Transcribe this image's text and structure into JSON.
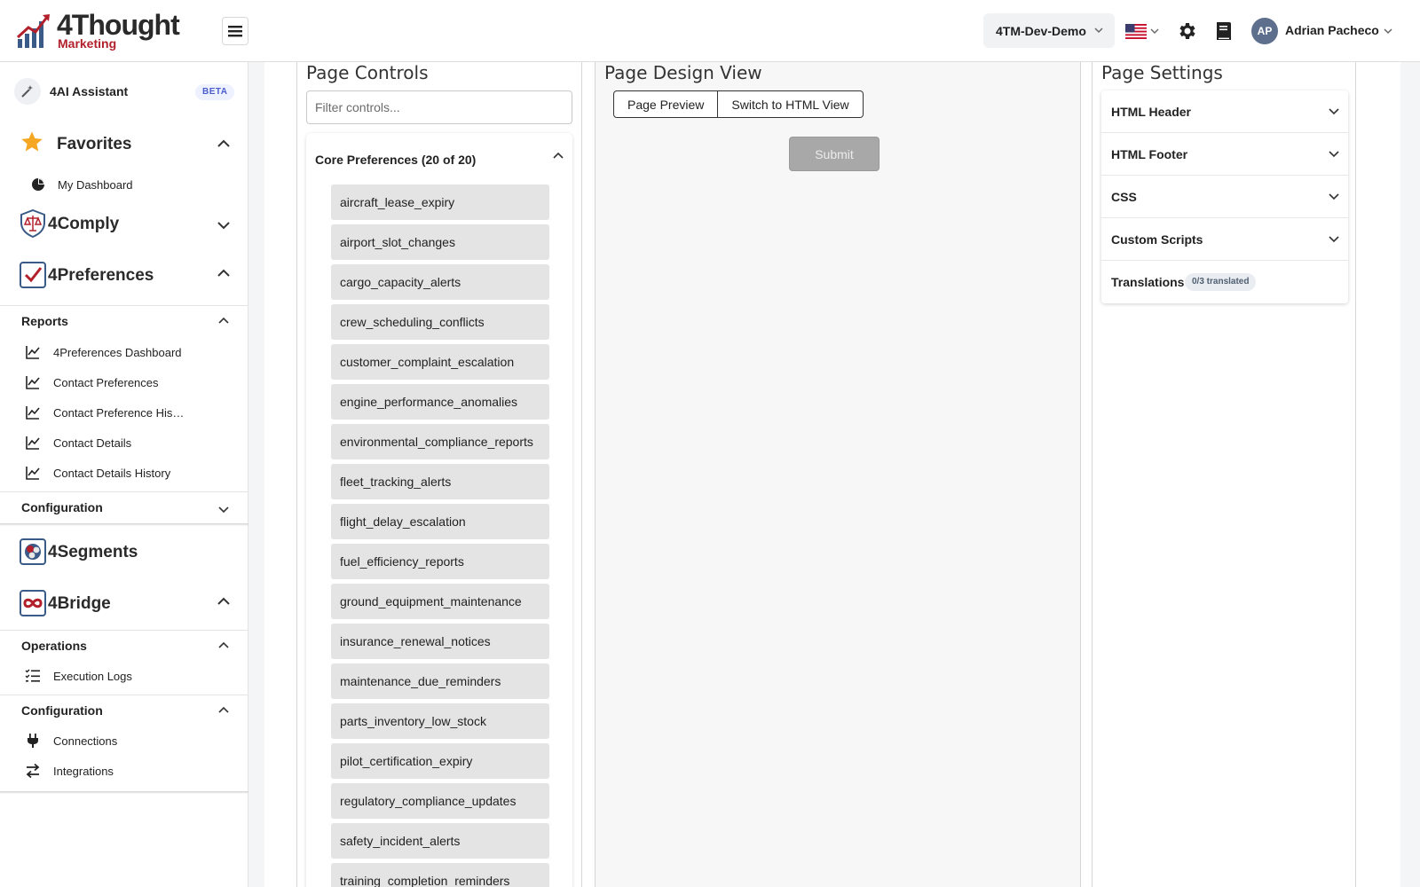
{
  "header": {
    "logo_name": "4Thought",
    "logo_sub": "Marketing",
    "org": "4TM-Dev-Demo",
    "user_initials": "AP",
    "user_name": "Adrian Pacheco"
  },
  "sidebar": {
    "ai_label": "4AI Assistant",
    "ai_badge": "BETA",
    "favorites": {
      "title": "Favorites",
      "items": [
        "My Dashboard"
      ]
    },
    "comply": {
      "title": "4Comply"
    },
    "preferences": {
      "title": "4Preferences",
      "reports_title": "Reports",
      "reports": [
        "4Preferences Dashboard",
        "Contact Preferences",
        "Contact Preference His…",
        "Contact Details",
        "Contact Details History"
      ],
      "configuration_title": "Configuration"
    },
    "segments": {
      "title": "4Segments"
    },
    "bridge": {
      "title": "4Bridge",
      "operations_title": "Operations",
      "operations": [
        "Execution Logs"
      ],
      "configuration_title": "Configuration",
      "configuration": [
        "Connections",
        "Integrations"
      ]
    }
  },
  "controls": {
    "title": "Page Controls",
    "filter_placeholder": "Filter controls...",
    "core_title": "Core Preferences (20 of 20)",
    "items": [
      "aircraft_lease_expiry",
      "airport_slot_changes",
      "cargo_capacity_alerts",
      "crew_scheduling_conflicts",
      "customer_complaint_escalation",
      "engine_performance_anomalies",
      "environmental_compliance_reports",
      "fleet_tracking_alerts",
      "flight_delay_escalation",
      "fuel_efficiency_reports",
      "ground_equipment_maintenance",
      "insurance_renewal_notices",
      "maintenance_due_reminders",
      "parts_inventory_low_stock",
      "pilot_certification_expiry",
      "regulatory_compliance_updates",
      "safety_incident_alerts",
      "training_completion_reminders"
    ]
  },
  "design": {
    "title": "Page Design View",
    "preview_label": "Page Preview",
    "html_view_label": "Switch to HTML View",
    "submit_label": "Submit"
  },
  "settings": {
    "title": "Page Settings",
    "html_header": "HTML Header",
    "html_footer": "HTML Footer",
    "css": "CSS",
    "custom_scripts": "Custom Scripts",
    "translations": "Translations",
    "translations_badge": "0/3 translated"
  },
  "colors": {
    "brand_red": "#b2202b",
    "brand_blue": "#3a5a87",
    "star": "#f5a623"
  }
}
